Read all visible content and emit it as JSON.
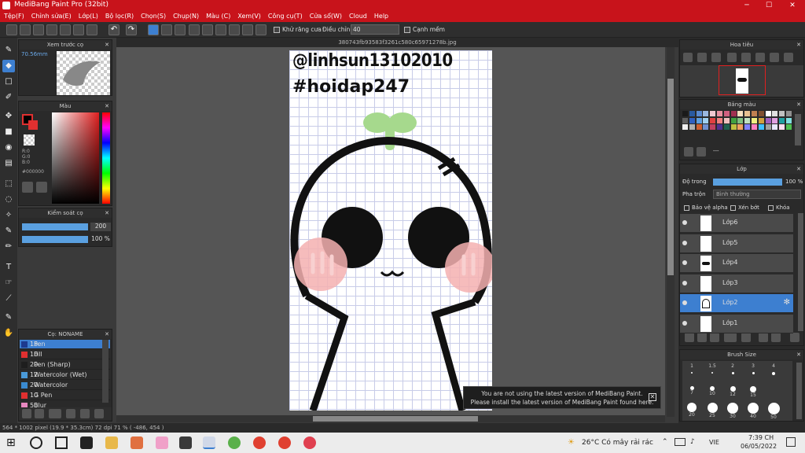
{
  "window": {
    "title": "MediBang Paint Pro (32bit)",
    "minimize": "─",
    "maximize": "☐",
    "close": "✕"
  },
  "menu": [
    "Tệp(F)",
    "Chỉnh sửa(E)",
    "Lớp(L)",
    "Bộ lọc(R)",
    "Chọn(S)",
    "Chụp(N)",
    "Màu (C)",
    "Xem(V)",
    "Công cụ(T)",
    "Cửa sổ(W)",
    "Cloud",
    "Help"
  ],
  "toolbar": {
    "antialias_label": "Khử răng cưa",
    "adjust_label": "Điều chỉnh",
    "adjust_value": "40",
    "soften_label": "Cạnh mềm"
  },
  "document": {
    "filename": "380743fb93583f3261c580c65971278b.jpg",
    "text1": "@linhsun13102010",
    "text2": "#hoidap247"
  },
  "preview_panel": {
    "title": "Xem trước cọ",
    "size": "70.56mm"
  },
  "color_panel": {
    "title": "Màu",
    "r": "R:0",
    "g": "G:0",
    "b": "B:0",
    "hex": "#000000"
  },
  "brush_control": {
    "title": "Kiểm soát cọ",
    "size": "200",
    "opacity": "100 %"
  },
  "brush_panel": {
    "title": "Cọ: NONAME",
    "items": [
      {
        "size": "15",
        "name": "Pen",
        "color": "#1d3a8f"
      },
      {
        "size": "10",
        "name": "Fill",
        "color": "#e03030"
      },
      {
        "size": "20",
        "name": "Pen (Sharp)",
        "color": "#1e1e1e"
      },
      {
        "size": "12",
        "name": "Watercolor (Wet)",
        "color": "#4a9ad8"
      },
      {
        "size": "20",
        "name": "Watercolor",
        "color": "#3a8ad0"
      },
      {
        "size": "10",
        "name": "G Pen",
        "color": "#e03030"
      },
      {
        "size": "50",
        "name": "Blur",
        "color": "#e888c0"
      }
    ]
  },
  "navigator": {
    "title": "Hoa tiêu"
  },
  "palette": {
    "title": "Bảng màu",
    "add_label": "---"
  },
  "layer_panel": {
    "title": "Lớp",
    "opacity_label": "Độ trong",
    "opacity_value": "100 %",
    "blend_label": "Pha trộn",
    "blend_value": "Bình thường",
    "protect_alpha": "Bảo vệ alpha",
    "clipping": "Xén bớt",
    "lock": "Khóa",
    "layers": [
      "Lớp6",
      "Lớp5",
      "Lớp4",
      "Lớp3",
      "Lớp2",
      "Lớp1"
    ]
  },
  "brush_size": {
    "title": "Brush Size",
    "row1": [
      "1",
      "1.5",
      "2",
      "3",
      "4"
    ],
    "row2": [
      "7",
      "10",
      "12",
      "15"
    ],
    "row3": [
      "20",
      "25",
      "30",
      "40",
      "50"
    ]
  },
  "notice": {
    "line1": "You are not using the latest version of MediBang Paint.",
    "line2": "Please install the latest version of MediBang Paint found here."
  },
  "status": "564 * 1002 pixel  (19.9 * 35.3cm)  72 dpi  71 %  ( -486, 454 )",
  "taskbar": {
    "weather": "26°C  Có mây rải rác",
    "lang": "VIE",
    "time": "7:39 CH",
    "date": "06/05/2022"
  },
  "colors": {
    "accent": "#3d7fd0",
    "titlebar": "#c8131b",
    "sprout": "#a6d98d",
    "blush": "#f4b0b0"
  }
}
